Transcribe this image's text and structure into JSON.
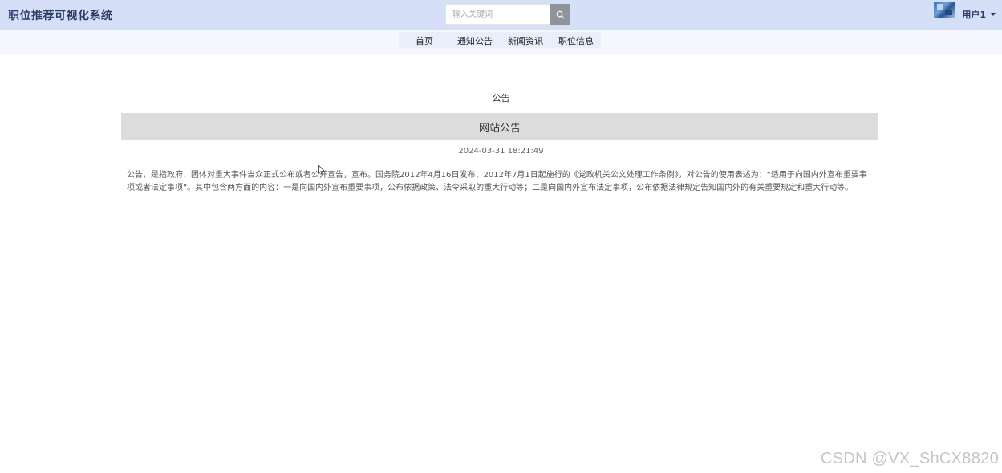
{
  "header": {
    "app_title": "职位推荐可视化系统",
    "search": {
      "placeholder": "输入关键词",
      "value": "",
      "icon": "search-icon"
    },
    "user": {
      "name": "用户1",
      "avatar": "avatar-image"
    }
  },
  "nav": {
    "items": [
      {
        "label": "首页"
      },
      {
        "label": "通知公告"
      },
      {
        "label": "新闻资讯"
      },
      {
        "label": "职位信息"
      }
    ]
  },
  "main": {
    "section_label": "公告",
    "notice": {
      "title": "网站公告",
      "time": "2024-03-31 18:21:49",
      "body": "公告，是指政府、团体对重大事件当众正式公布或者公开宣告，宣布。国务院2012年4月16日发布、2012年7月1日起施行的《党政机关公文处理工作条例》，对公告的使用表述为：“适用于向国内外宣布重要事项或者法定事项”。其中包含两方面的内容：一是向国内外宣布重要事项，公布依据政策、法令采取的重大行动等；二是向国内外宣布法定事项，公布依据法律规定告知国内外的有关重要规定和重大行动等。"
    }
  },
  "watermark": "CSDN @VX_ShCX8820"
}
